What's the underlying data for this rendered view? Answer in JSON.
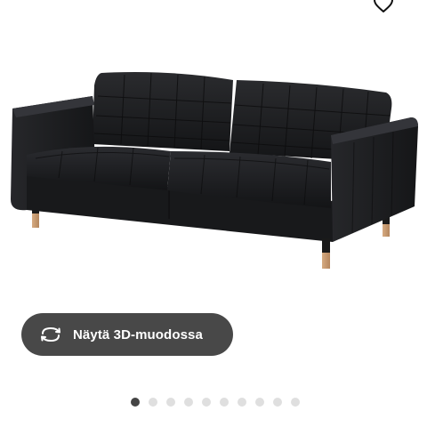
{
  "product": {
    "image_alt": "Musta nahkasohva puujaloilla",
    "view_3d_label": "Näytä 3D-muodossa",
    "view_3d_icon": "rotate-3d-icon",
    "wishlist_icon": "heart-icon"
  },
  "carousel": {
    "total": 10,
    "active_index": 0
  },
  "colors": {
    "button_bg": "#484848",
    "button_text": "#ffffff",
    "dot_active": "#444444",
    "dot_inactive": "#dfdfdf",
    "sofa_leather": "#1d1e20",
    "leg_wood": "#c79b72"
  }
}
